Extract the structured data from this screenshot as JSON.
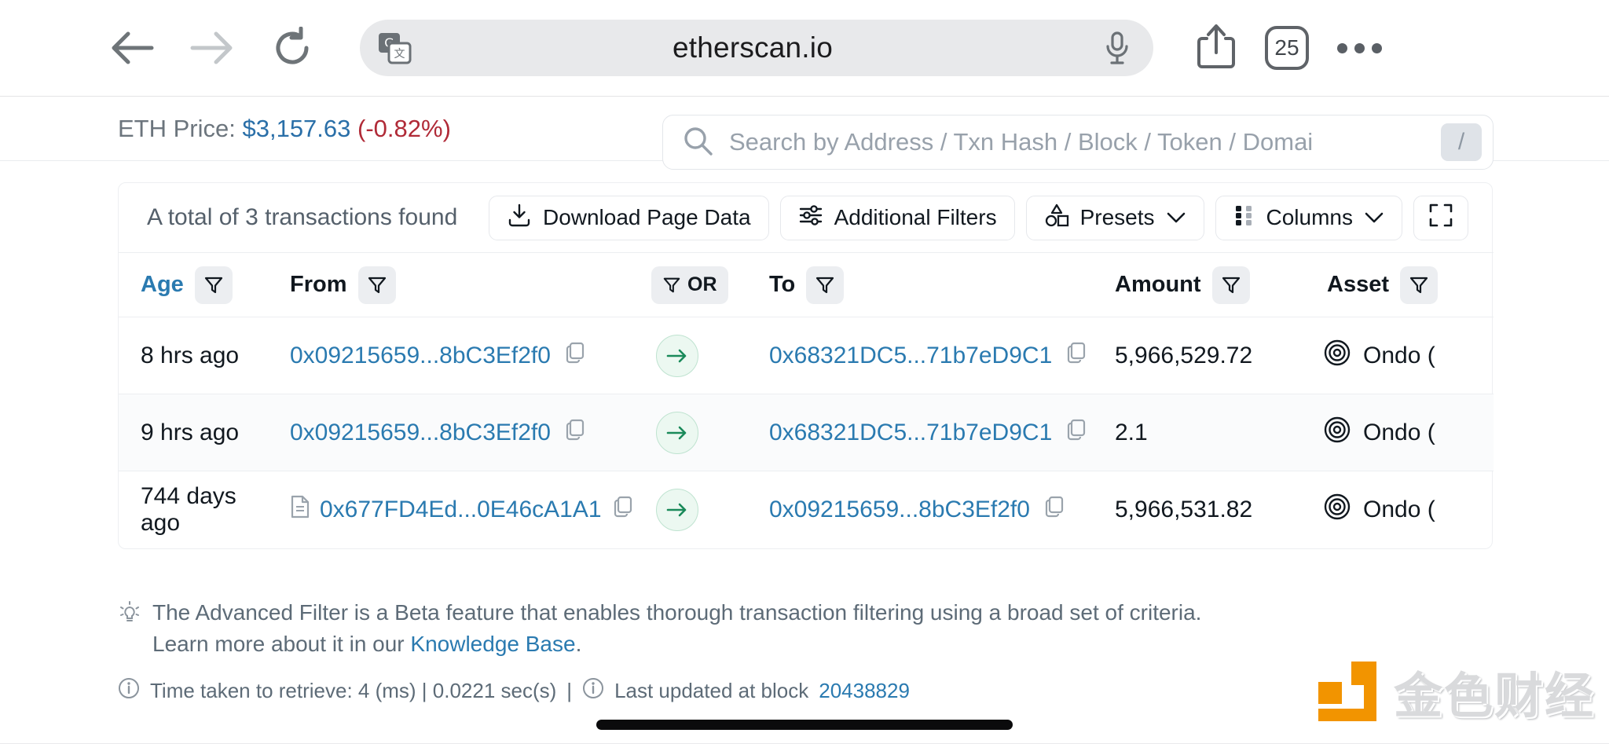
{
  "browser": {
    "url": "etherscan.io",
    "tab_count": "25",
    "back_icon": "back-arrow-icon",
    "forward_icon": "forward-arrow-icon",
    "reload_icon": "reload-icon",
    "translate_icon": "translate-icon",
    "mic_icon": "microphone-icon",
    "share_icon": "share-icon",
    "more_icon": "more-options-icon"
  },
  "header": {
    "eth_price_label": "ETH Price:",
    "eth_price_value": "$3,157.63",
    "eth_price_delta": "(-0.82%)",
    "search_placeholder": "Search by Address / Txn Hash / Block / Token / Domai",
    "search_value": "",
    "search_shortcut": "/"
  },
  "toolbar": {
    "total_text": "A total of 3 transactions found",
    "download_label": "Download Page Data",
    "filters_label": "Additional Filters",
    "presets_label": "Presets",
    "columns_label": "Columns",
    "fullscreen_label": ""
  },
  "table": {
    "columns": [
      {
        "key": "age",
        "label": "Age",
        "sorted": true,
        "filter": true
      },
      {
        "key": "from",
        "label": "From",
        "sorted": false,
        "filter": true
      },
      {
        "key": "or",
        "label": "OR",
        "sorted": false,
        "filter": true
      },
      {
        "key": "to",
        "label": "To",
        "sorted": false,
        "filter": true
      },
      {
        "key": "amount",
        "label": "Amount",
        "sorted": false,
        "filter": true
      },
      {
        "key": "asset",
        "label": "Asset",
        "sorted": false,
        "filter": true
      }
    ],
    "rows": [
      {
        "age": "8 hrs ago",
        "from": "0x09215659...8bC3Ef2f0",
        "from_is_contract": false,
        "direction": "out",
        "to": "0x68321DC5...71b7eD9C1",
        "amount": "5,966,529.72",
        "asset": "Ondo ("
      },
      {
        "age": "9 hrs ago",
        "from": "0x09215659...8bC3Ef2f0",
        "from_is_contract": false,
        "direction": "out",
        "to": "0x68321DC5...71b7eD9C1",
        "amount": "2.1",
        "asset": "Ondo ("
      },
      {
        "age": "744 days ago",
        "from": "0x677FD4Ed...0E46cA1A1",
        "from_is_contract": true,
        "direction": "out",
        "to": "0x09215659...8bC3Ef2f0",
        "amount": "5,966,531.82",
        "asset": "Ondo ("
      }
    ]
  },
  "notes": {
    "beta_text": "The Advanced Filter is a Beta feature that enables thorough transaction filtering using a broad set of criteria. Learn more about it in our",
    "knowledge_base_link": "Knowledge Base",
    "period": ".",
    "time_taken": "Time taken to retrieve: 4 (ms) | 0.0221 sec(s)",
    "separator": "|",
    "last_updated_label": "Last updated at block",
    "block_number": "20438829"
  },
  "watermark": {
    "text": "金色财经"
  },
  "colors": {
    "link": "#2a7ab0",
    "price": "#2a6fa8",
    "delta_negative": "#b02a37",
    "accent_green": "#1a8a5a",
    "watermark_orange": "#f29400"
  }
}
